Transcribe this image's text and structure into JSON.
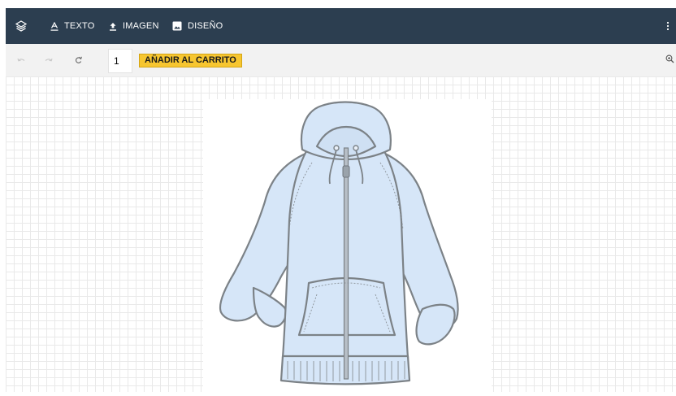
{
  "toolbar": {
    "layers_icon": "layers-icon",
    "text_label": "TEXTO",
    "image_label": "IMAGEN",
    "design_label": "DISEÑO",
    "more_icon": "more-vert-icon",
    "bg_color": "#2c3e50"
  },
  "subbar": {
    "undo_icon": "undo-icon",
    "redo_icon": "redo-icon",
    "refresh_icon": "refresh-icon",
    "quantity": "1",
    "add_to_cart_label": "AÑADIR AL CARRITO",
    "add_to_cart_color": "#f7c630",
    "zoom_icon": "zoom-in-icon"
  },
  "canvas": {
    "product_image": "hoodie-image",
    "hoodie_color": "#d6e6f8"
  }
}
